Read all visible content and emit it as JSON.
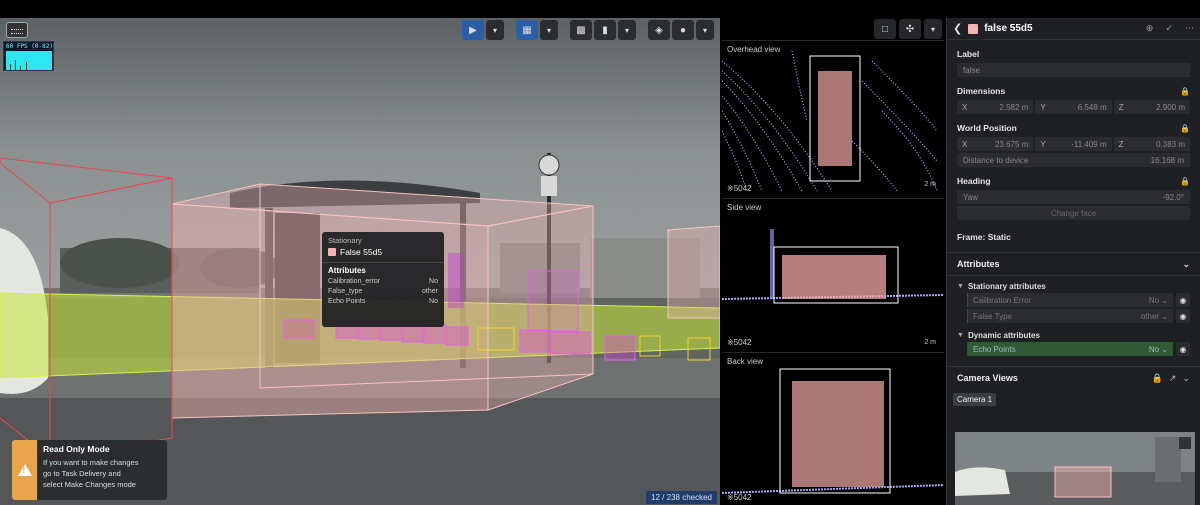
{
  "camera": {
    "fps_label": "60 FPS (0-82)",
    "tooltip": {
      "class_name": "Stationary",
      "object_name": "False 55d5",
      "attributes_heading": "Attributes",
      "rows": [
        {
          "key": "Calibration_error",
          "value": "No"
        },
        {
          "key": "False_type",
          "value": "other"
        },
        {
          "key": "Echo Points",
          "value": "No"
        }
      ]
    },
    "read_only": {
      "title": "Read Only Mode",
      "line1": "If you want to make changes",
      "line2": "go to Task Delivery and",
      "line3": "select Make Changes mode"
    },
    "checked_status": "12 / 238 checked"
  },
  "lidar": {
    "panels": [
      {
        "title": "Overhead view",
        "id": "5042",
        "scale": "2 m"
      },
      {
        "title": "Side view",
        "id": "5042",
        "scale": "2 m"
      },
      {
        "title": "Back view",
        "id": "5042",
        "scale": ""
      }
    ]
  },
  "properties": {
    "title": "false 55d5",
    "label_heading": "Label",
    "label_value": "false",
    "dimensions_heading": "Dimensions",
    "dimensions": {
      "x": "2.582 m",
      "y": "6.548 m",
      "z": "2.900 m"
    },
    "world_position_heading": "World Position",
    "world_position": {
      "x": "23.675 m",
      "y": "-11.409 m",
      "z": "0.383 m"
    },
    "distance_label": "Distance to device",
    "distance_value": "16.168 m",
    "heading_heading": "Heading",
    "yaw_label": "Yaw",
    "yaw_value": "-92.0°",
    "change_face": "Change face",
    "frame": "Frame: Static",
    "attributes_heading": "Attributes",
    "stationary_heading": "Stationary attributes",
    "stationary_rows": [
      {
        "key": "Calibration Error",
        "value": "No"
      },
      {
        "key": "False Type",
        "value": "other"
      }
    ],
    "dynamic_heading": "Dynamic attributes",
    "dynamic_rows": [
      {
        "key": "Echo Points",
        "value": "No"
      }
    ],
    "camera_views_heading": "Camera Views",
    "camera_tab": "Camera 1"
  },
  "colors": {
    "accent": "#2a5fa8",
    "selected_box": "#f4b4b4",
    "warning": "#e8a54b",
    "lidar_points": "#a9a8ff",
    "dynamic_row": "#2f5a35"
  }
}
